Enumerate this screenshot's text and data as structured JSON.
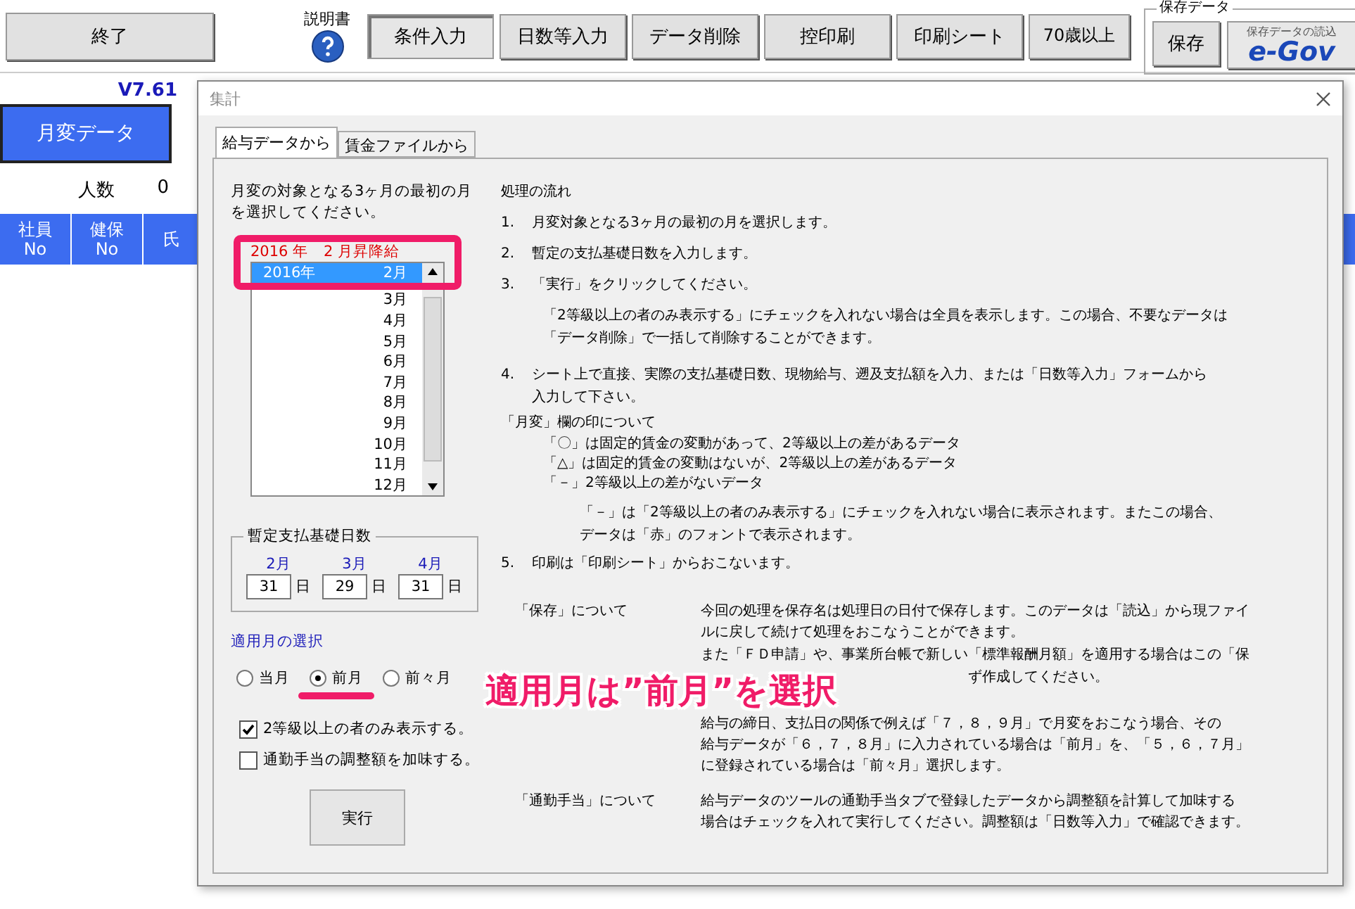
{
  "toolbar": {
    "exit_button": "終了",
    "manual_label": "説明書",
    "buttons": [
      {
        "label": "条件入力",
        "selected": true
      },
      {
        "label": "日数等入力",
        "selected": false
      },
      {
        "label": "データ削除",
        "selected": false
      },
      {
        "label": "控印刷",
        "selected": false
      },
      {
        "label": "印刷シート",
        "selected": false
      },
      {
        "label": "70歳以上",
        "selected": false
      }
    ],
    "save_group": {
      "title": "保存データ",
      "save_button": "保存",
      "egov_caption": "保存データの読込",
      "egov_label": "e-Gov"
    }
  },
  "sheet": {
    "version": "V7.61",
    "main_button": "月変データ",
    "count_label": "人数",
    "count": "0",
    "columns": [
      {
        "lines": [
          "社員",
          "No"
        ]
      },
      {
        "lines": [
          "健保",
          "No"
        ]
      },
      {
        "lines": [
          "氏"
        ]
      }
    ]
  },
  "dialog": {
    "title": "集計",
    "tabs": [
      {
        "label": "給与データから",
        "selected": true
      },
      {
        "label": "賃金ファイルから",
        "selected": false
      }
    ],
    "month_prompt": "月変の対象となる3ヶ月の最初の月を選択してください。",
    "list_caption": "2016 年　2 月昇降給",
    "month_list": [
      {
        "year": "2016年",
        "month": "2月",
        "selected": true
      },
      {
        "month": "3月",
        "selected": false
      },
      {
        "month": "4月",
        "selected": false
      },
      {
        "month": "5月",
        "selected": false
      },
      {
        "month": "6月",
        "selected": false
      },
      {
        "month": "7月",
        "selected": false
      },
      {
        "month": "8月",
        "selected": false
      },
      {
        "month": "9月",
        "selected": false
      },
      {
        "month": "10月",
        "selected": false
      },
      {
        "month": "11月",
        "selected": false
      },
      {
        "month": "12月",
        "selected": false
      }
    ],
    "days_group": {
      "title": "暫定支払基礎日数",
      "fields": [
        {
          "month": "2月",
          "value": "31",
          "unit": "日"
        },
        {
          "month": "3月",
          "value": "29",
          "unit": "日"
        },
        {
          "month": "4月",
          "value": "31",
          "unit": "日"
        }
      ]
    },
    "apply_month": {
      "title": "適用月の選択",
      "options": [
        {
          "label": "当月",
          "selected": false
        },
        {
          "label": "前月",
          "selected": true
        },
        {
          "label": "前々月",
          "selected": false
        }
      ]
    },
    "checkboxes": [
      {
        "label": "2等級以上の者のみ表示する。",
        "checked": true
      },
      {
        "label": "通勤手当の調整額を加味する。",
        "checked": false
      }
    ],
    "run_button": "実行",
    "guide": {
      "heading": "処理の流れ",
      "steps": [
        {
          "number": "1.",
          "lines": [
            "月変対象となる3ヶ月の最初の月を選択します。"
          ]
        },
        {
          "number": "2.",
          "lines": [
            "暫定の支払基礎日数を入力します。"
          ]
        },
        {
          "number": "3.",
          "lines": [
            "「実行」をクリックしてください。"
          ],
          "note": [
            "「2等級以上の者のみ表示する」にチェックを入れない場合は全員を表示します。この場合、不要なデータは",
            "「データ削除」で一括して削除することができます。"
          ]
        },
        {
          "number": "4.",
          "lines": [
            "シート上で直接、実際の支払基礎日数、現物給与、遡及支払額を入力、または「日数等入力」フォームから",
            "入力して下さい。"
          ]
        }
      ],
      "marks_heading": "「月変」欄の印について",
      "marks": [
        "「〇」は固定的賃金の変動があって、2等級以上の差があるデータ",
        "「△」は固定的賃金の変動はないが、2等級以上の差があるデータ",
        "「－」2等級以上の差がないデータ"
      ],
      "marks_note": [
        "「－」は「2等級以上の者のみ表示する」にチェックを入れない場合に表示されます。またこの場合、",
        "データは「赤」のフォントで表示されます。"
      ],
      "last_step": {
        "number": "5.",
        "text": "印刷は「印刷シート」からおこないます。"
      },
      "sections": [
        {
          "label": "「保存」について",
          "paragraphs": [
            [
              "今回の処理を保存名は処理日の日付で保存します。このデータは「読込」から現ファイ",
              "ルに戻して続けて処理をおこなうことができます。"
            ],
            [
              "また「ＦＤ申請」や、事業所台帳で新しい「標準報酬月額」を適用する場合はこの「保"
            ]
          ],
          "fragment": "ず作成してください。"
        },
        {
          "paragraphs": [
            [
              "給与の締日、支払日の関係で例えば「７，８，９月」で月変をおこなう場合、その",
              "給与データが「６，７，８月」に入力されている場合は「前月」を、「５，６，７月」",
              "に登録されている場合は「前々月」選択します。"
            ]
          ]
        },
        {
          "label": "「通勤手当」について",
          "paragraphs": [
            [
              "給与データのツールの通勤手当タブで登録したデータから調整額を計算して加味する",
              "場合はチェックを入れて実行してください。調整額は「日数等入力」で確認できます。"
            ]
          ]
        }
      ]
    }
  },
  "annotation": {
    "text": "適用月は”前月”を選択"
  }
}
